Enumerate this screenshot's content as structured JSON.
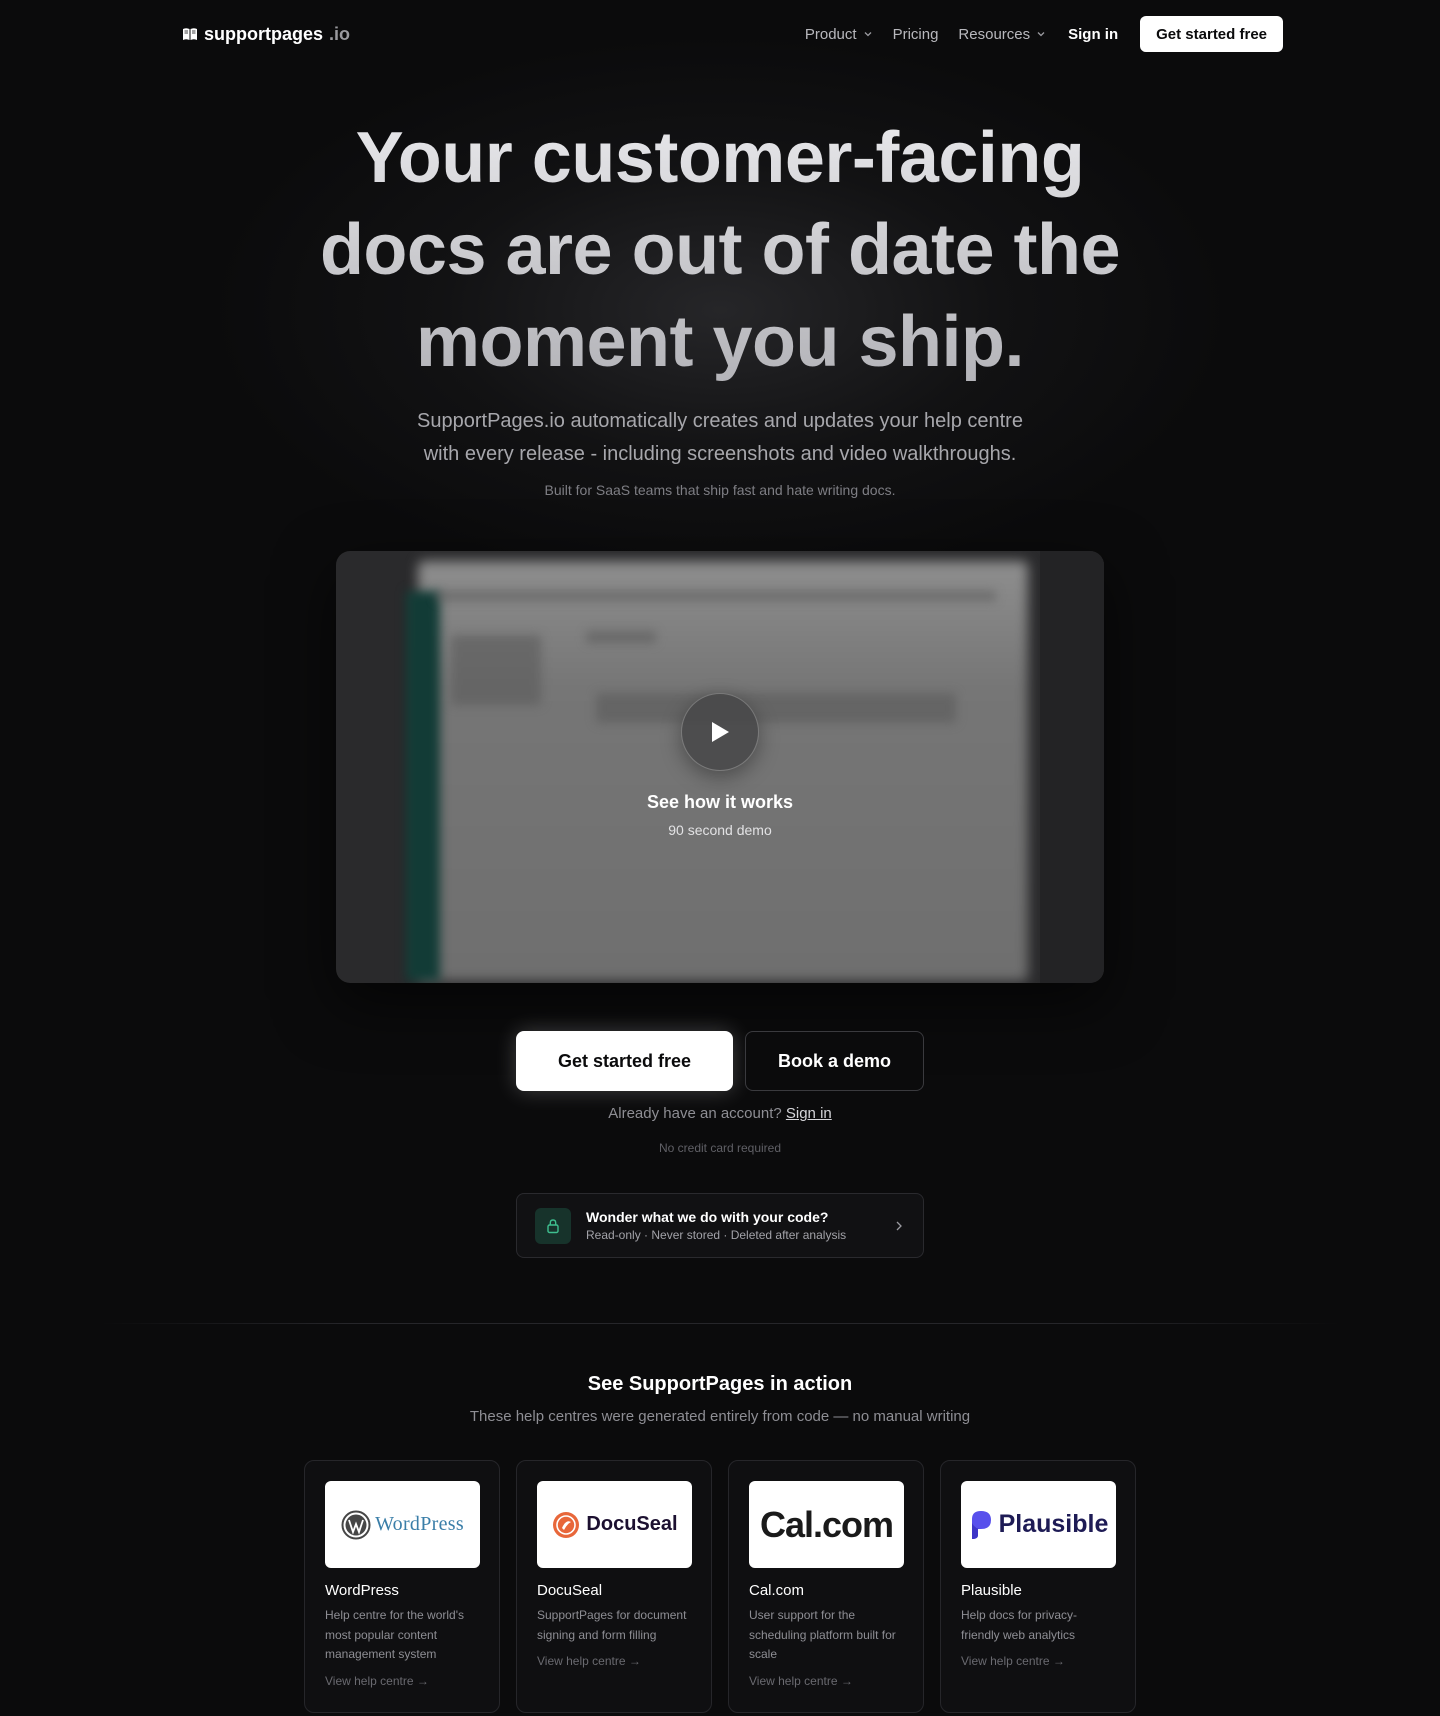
{
  "brand": {
    "name": "supportpages",
    "tld": ".io"
  },
  "nav": {
    "product": "Product",
    "pricing": "Pricing",
    "resources": "Resources",
    "sign_in": "Sign in",
    "cta": "Get started free"
  },
  "hero": {
    "title_line1": "Your customer-facing",
    "title_line2": "docs are out of date the",
    "title_line3": "moment you ship.",
    "subtitle_line1": "SupportPages.io automatically creates and updates your help centre",
    "subtitle_line2": "with every release - including screenshots and video walkthroughs.",
    "note": "Built for SaaS teams that ship fast and hate writing docs."
  },
  "video": {
    "title": "See how it works",
    "subtitle": "90 second demo"
  },
  "cta": {
    "primary": "Get started free",
    "secondary": "Book a demo",
    "account_prompt": "Already have an account?",
    "account_link": "Sign in",
    "no_card": "No credit card required"
  },
  "code_card": {
    "title": "Wonder what we do with your code?",
    "subtitle": "Read-only · Never stored · Deleted after analysis"
  },
  "showcase": {
    "title": "See SupportPages in action",
    "subtitle": "These help centres were generated entirely from code — no manual writing",
    "cards": [
      {
        "logo_text": "WordPress",
        "name": "WordPress",
        "description": "Help centre for the world's most popular content management system",
        "link": "View help centre →"
      },
      {
        "logo_text": "DocuSeal",
        "name": "DocuSeal",
        "description": "SupportPages for document signing and form filling",
        "link": "View help centre →"
      },
      {
        "logo_text": "Cal.com",
        "name": "Cal.com",
        "description": "User support for the scheduling platform built for scale",
        "link": "View help centre →"
      },
      {
        "logo_text": "Plausible",
        "name": "Plausible",
        "description": "Help docs for privacy-friendly web analytics",
        "link": "View help centre →"
      }
    ]
  },
  "colors": {
    "background": "#0b0b0c",
    "lock_accent": "#3fbf8f",
    "wordpress_blue": "#3a7ea8",
    "docuseal_orange": "#e8673a",
    "plausible_indigo": "#5850ec"
  },
  "icons": [
    "book-icon",
    "chevron-down-icon",
    "play-icon",
    "lock-icon",
    "chevron-right-icon"
  ]
}
